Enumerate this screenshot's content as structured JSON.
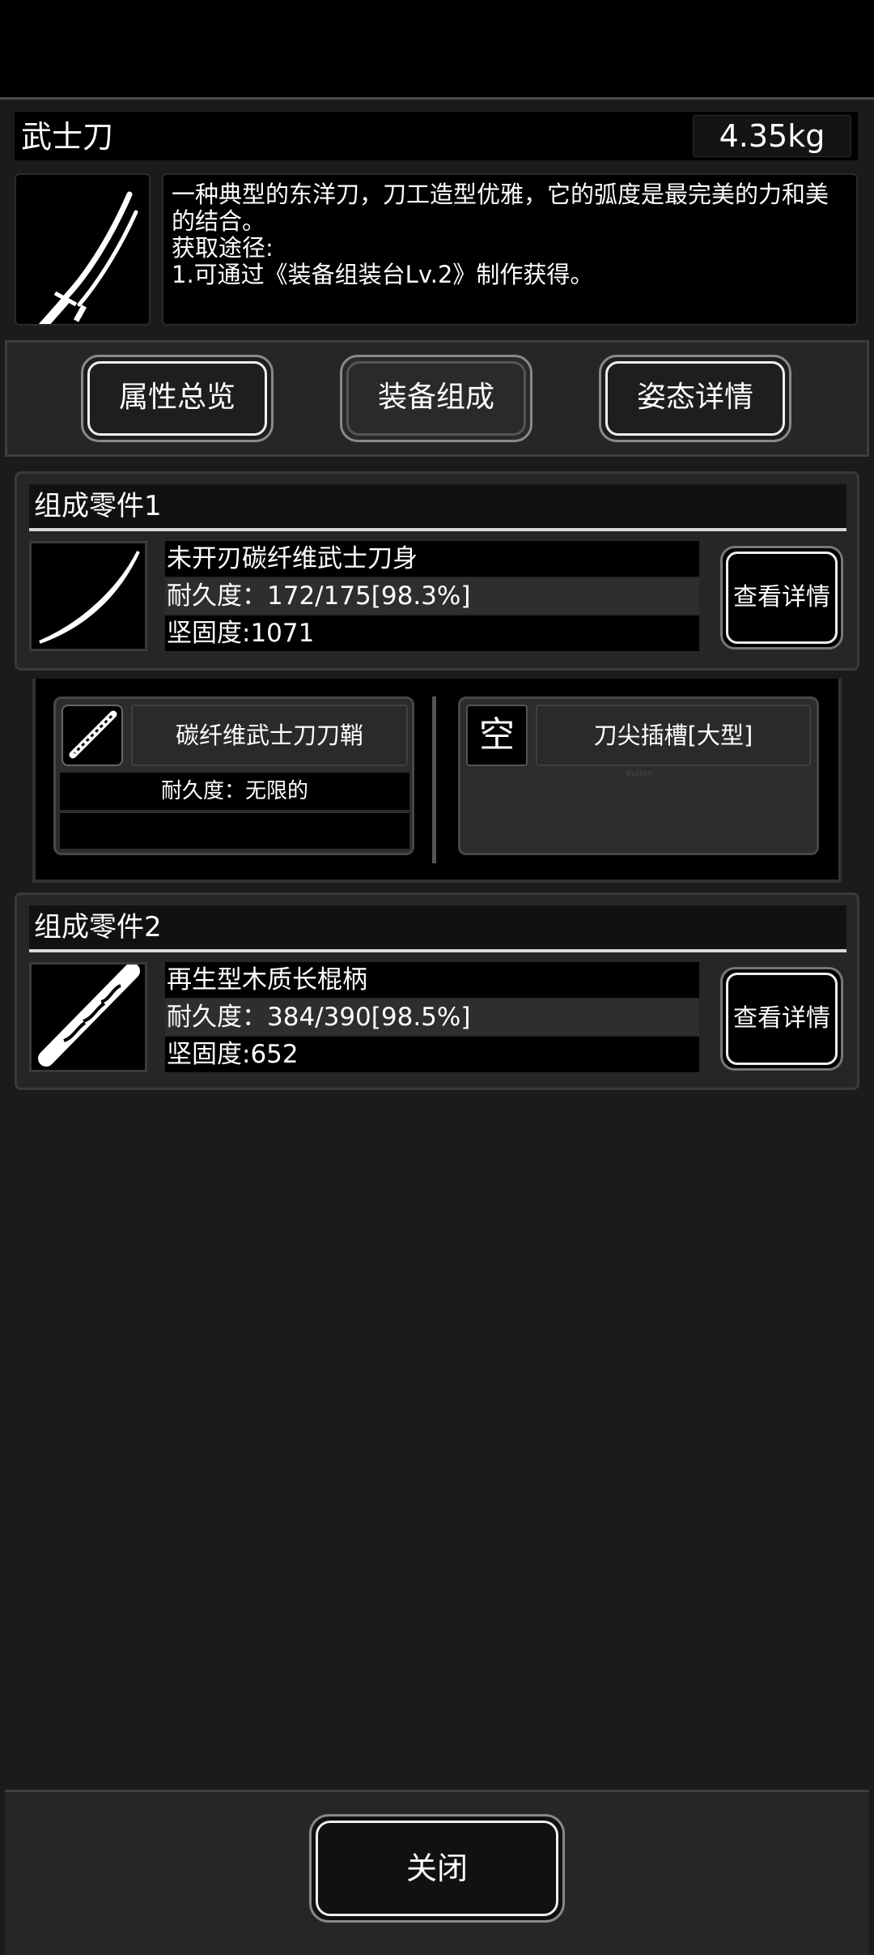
{
  "item": {
    "name": "武士刀",
    "weight": "4.35kg",
    "description": "一种典型的东洋刀，刀工造型优雅，它的弧度是最完美的力和美的结合。",
    "source_label": "获取途径:",
    "source_line": "1.可通过《装备组装台Lv.2》制作获得。"
  },
  "tabs": [
    {
      "label": "属性总览"
    },
    {
      "label": "装备组成"
    },
    {
      "label": "姿态详情"
    }
  ],
  "parts": [
    {
      "header": "组成零件1",
      "name": "未开刃碳纤维武士刀身",
      "durability": "耐久度：172/175[98.3%]",
      "hardness": "坚固度:1071",
      "detail_label": "查看详情"
    },
    {
      "header": "组成零件2",
      "name": "再生型木质长棍柄",
      "durability": "耐久度：384/390[98.5%]",
      "hardness": "坚固度:652",
      "detail_label": "查看详情"
    }
  ],
  "subparts": {
    "sheath": {
      "name": "碳纤维武士刀刀鞘",
      "durability": "耐久度：无限的"
    },
    "slot": {
      "empty_glyph": "空",
      "name": "刀尖插槽[大型]",
      "ghost_label": "Button"
    }
  },
  "footer": {
    "close_label": "关闭"
  }
}
